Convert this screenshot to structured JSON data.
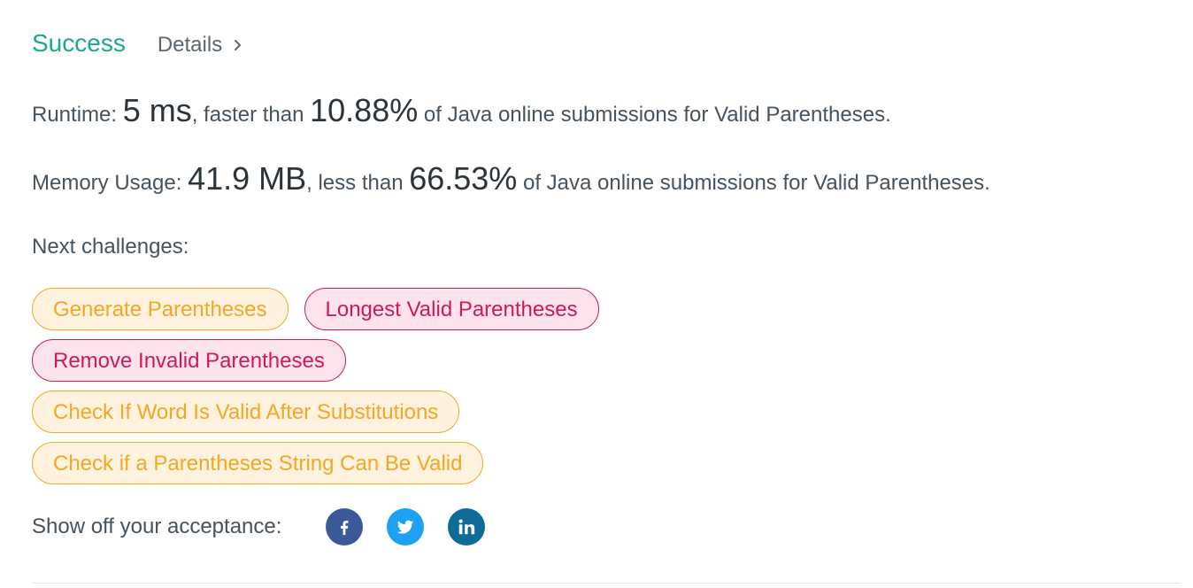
{
  "header": {
    "status": "Success",
    "details_label": "Details"
  },
  "runtime": {
    "label": "Runtime: ",
    "value": "5 ms",
    "mid": ", faster than ",
    "percent": "10.88%",
    "suffix": " of Java online submissions for Valid Parentheses."
  },
  "memory": {
    "label": "Memory Usage: ",
    "value": "41.9 MB",
    "mid": ", less than ",
    "percent": "66.53%",
    "suffix": " of Java online submissions for Valid Parentheses."
  },
  "next_challenges": {
    "label": "Next challenges:",
    "items": [
      {
        "label": "Generate Parentheses",
        "difficulty": "medium"
      },
      {
        "label": "Longest Valid Parentheses",
        "difficulty": "hard"
      },
      {
        "label": "Remove Invalid Parentheses",
        "difficulty": "hard"
      },
      {
        "label": "Check If Word Is Valid After Substitutions",
        "difficulty": "medium"
      },
      {
        "label": "Check if a Parentheses String Can Be Valid",
        "difficulty": "medium"
      }
    ]
  },
  "share": {
    "label": "Show off your acceptance:",
    "icons": [
      "facebook-icon",
      "twitter-icon",
      "linkedin-icon"
    ]
  },
  "colors": {
    "success": "#1ba88e",
    "medium": "#f5a623",
    "hard": "#d0185c",
    "facebook": "#3b5898",
    "twitter": "#1da1f2",
    "linkedin": "#0e6a96"
  }
}
